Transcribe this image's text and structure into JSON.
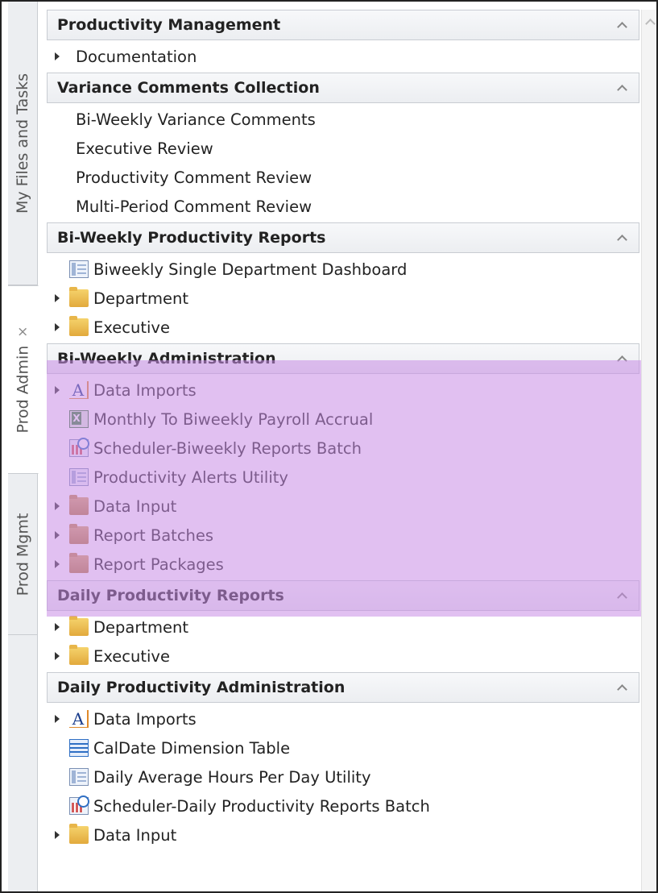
{
  "tabs": [
    {
      "label": "My Files and Tasks",
      "closable": false,
      "active": false
    },
    {
      "label": "Prod Admin",
      "closable": true,
      "active": true
    },
    {
      "label": "Prod Mgmt",
      "closable": false,
      "active": false
    }
  ],
  "tab_close_glyph": "×",
  "highlight_color": "#c88ce6",
  "sections": [
    {
      "title": "Productivity Management",
      "items": [
        {
          "label": "Documentation",
          "expandable": true,
          "icon": "none"
        }
      ]
    },
    {
      "title": "Variance Comments Collection",
      "items": [
        {
          "label": "Bi-Weekly Variance Comments",
          "expandable": false,
          "icon": "none"
        },
        {
          "label": "Executive Review",
          "expandable": false,
          "icon": "none"
        },
        {
          "label": "Productivity Comment Review",
          "expandable": false,
          "icon": "none"
        },
        {
          "label": "Multi-Period Comment Review",
          "expandable": false,
          "icon": "none"
        }
      ]
    },
    {
      "title": "Bi-Weekly Productivity Reports",
      "items": [
        {
          "label": "Biweekly Single Department Dashboard",
          "expandable": false,
          "icon": "dashboard-icon"
        },
        {
          "label": "Department",
          "expandable": true,
          "icon": "folder-icon"
        },
        {
          "label": "Executive",
          "expandable": true,
          "icon": "folder-icon"
        }
      ]
    },
    {
      "title": "Bi-Weekly Administration",
      "items": [
        {
          "label": "Data Imports",
          "expandable": true,
          "icon": "data-import-icon"
        },
        {
          "label": "Monthly To Biweekly Payroll Accrual",
          "expandable": false,
          "icon": "excel-icon"
        },
        {
          "label": "Scheduler-Biweekly Reports Batch",
          "expandable": false,
          "icon": "scheduler-icon"
        },
        {
          "label": "Productivity Alerts Utility",
          "expandable": false,
          "icon": "dashboard-icon"
        },
        {
          "label": "Data Input",
          "expandable": true,
          "icon": "folder-icon"
        },
        {
          "label": "Report Batches",
          "expandable": true,
          "icon": "folder-icon"
        },
        {
          "label": "Report Packages",
          "expandable": true,
          "icon": "folder-icon"
        }
      ]
    },
    {
      "title": "Daily Productivity Reports",
      "items": [
        {
          "label": "Department",
          "expandable": true,
          "icon": "folder-icon"
        },
        {
          "label": "Executive",
          "expandable": true,
          "icon": "folder-icon"
        }
      ]
    },
    {
      "title": "Daily Productivity Administration",
      "items": [
        {
          "label": "Data Imports",
          "expandable": true,
          "icon": "data-import-icon"
        },
        {
          "label": "CalDate Dimension Table",
          "expandable": false,
          "icon": "table-icon"
        },
        {
          "label": "Daily Average Hours Per Day Utility",
          "expandable": false,
          "icon": "dashboard-icon"
        },
        {
          "label": "Scheduler-Daily Productivity Reports Batch",
          "expandable": false,
          "icon": "scheduler-icon"
        },
        {
          "label": "Data Input",
          "expandable": true,
          "icon": "folder-icon"
        }
      ]
    }
  ]
}
